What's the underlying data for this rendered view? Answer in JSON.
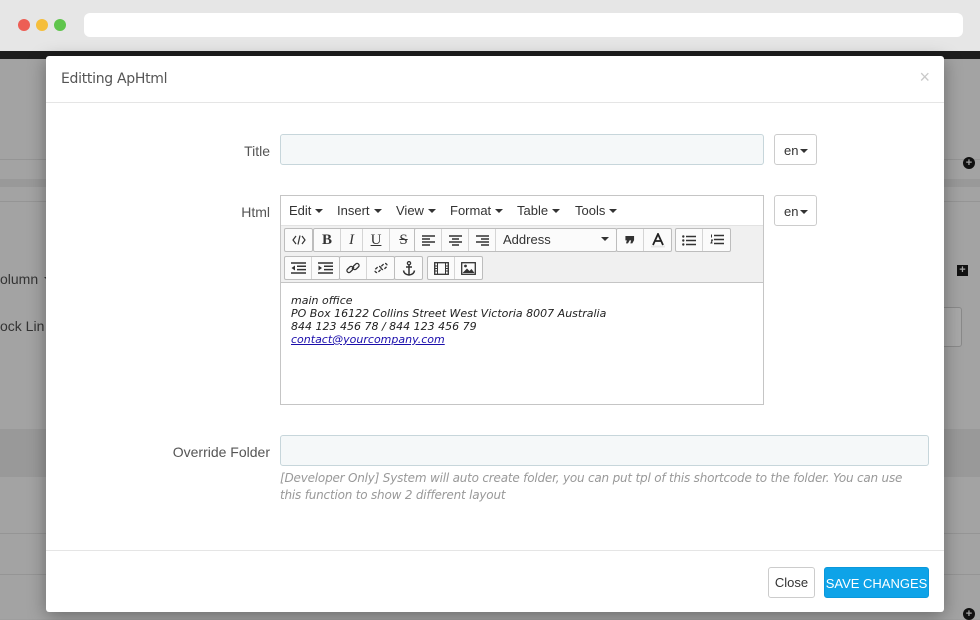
{
  "background": {
    "dropdown_label": "olumn",
    "row_label": "ock Lin"
  },
  "modal": {
    "title": "Editting ApHtml",
    "close_symbol": "×",
    "fields": {
      "title_label": "Title",
      "title_value": "",
      "title_lang": "en",
      "html_label": "Html",
      "html_lang": "en",
      "override_label": "Override Folder",
      "override_value": "",
      "override_help": "[Developer Only] System will auto create folder, you can put tpl of this shortcode to the folder. You can use this function to show 2 different layout"
    },
    "editor": {
      "menus": [
        "Edit",
        "Insert",
        "View",
        "Format",
        "Table",
        "Tools"
      ],
      "format_select": "Address",
      "content": {
        "line1": "main office",
        "line2": "PO Box 16122 Collins Street West Victoria 8007 Australia",
        "line3": "844 123 456 78 / 844 123 456 79",
        "email": "contact@yourcompany.com"
      }
    },
    "footer": {
      "close_label": "Close",
      "save_label": "SAVE CHANGES"
    }
  },
  "colors": {
    "primary_button": "#0ea3e8",
    "input_bg": "#f5f8f9",
    "overlay": "#a3a3a3"
  }
}
